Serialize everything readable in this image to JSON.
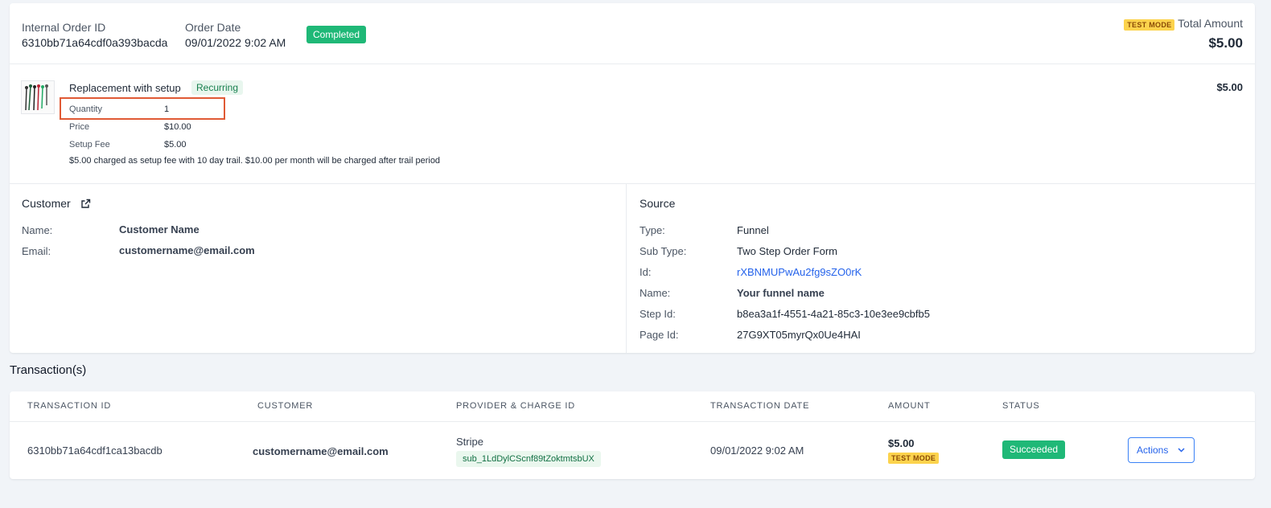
{
  "order": {
    "internal_order_id_label": "Internal Order ID",
    "internal_order_id": "6310bb71a64cdf0a393bacda",
    "order_date_label": "Order Date",
    "order_date": "09/01/2022 9:02 AM",
    "status": "Completed",
    "test_mode": "TEST MODE",
    "total_amount_label": "Total Amount",
    "total_amount": "$5.00"
  },
  "product": {
    "name": "Replacement with setup",
    "recurring_badge": "Recurring",
    "quantity_label": "Quantity",
    "quantity": "1",
    "price_label": "Price",
    "price": "$10.00",
    "setup_fee_label": "Setup Fee",
    "setup_fee": "$5.00",
    "note": "$5.00 charged as setup fee with 10 day trail. $10.00 per month will be charged after trail period",
    "line_total": "$5.00"
  },
  "customer": {
    "title": "Customer",
    "name_label": "Name:",
    "name": "Customer Name",
    "email_label": "Email:",
    "email": "customername@email.com"
  },
  "source": {
    "title": "Source",
    "type_label": "Type:",
    "type": "Funnel",
    "sub_type_label": "Sub Type:",
    "sub_type": "Two Step Order Form",
    "id_label": "Id:",
    "id": "rXBNMUPwAu2fg9sZO0rK",
    "name_label": "Name:",
    "name": "Your funnel name",
    "step_id_label": "Step Id:",
    "step_id": "b8ea3a1f-4551-4a21-85c3-10e3ee9cbfb5",
    "page_id_label": "Page Id:",
    "page_id": "27G9XT05myrQx0Ue4HAI"
  },
  "transactions": {
    "title": "Transaction(s)",
    "headers": {
      "transaction_id": "TRANSACTION ID",
      "customer": "CUSTOMER",
      "provider": "PROVIDER & CHARGE ID",
      "date": "TRANSACTION DATE",
      "amount": "AMOUNT",
      "status": "STATUS"
    },
    "rows": [
      {
        "transaction_id": "6310bb71a64cdf1ca13bacdb",
        "customer": "customername@email.com",
        "provider": "Stripe",
        "charge_id": "sub_1LdDylCScnf89tZoktmtsbUX",
        "date": "09/01/2022 9:02 AM",
        "amount": "$5.00",
        "test_mode": "TEST MODE",
        "status": "Succeeded",
        "actions_label": "Actions"
      }
    ]
  },
  "colors": {
    "success": "#1fb877",
    "test_mode": "#fcd34d",
    "link": "#2563eb",
    "highlight_box": "#e05a35"
  }
}
